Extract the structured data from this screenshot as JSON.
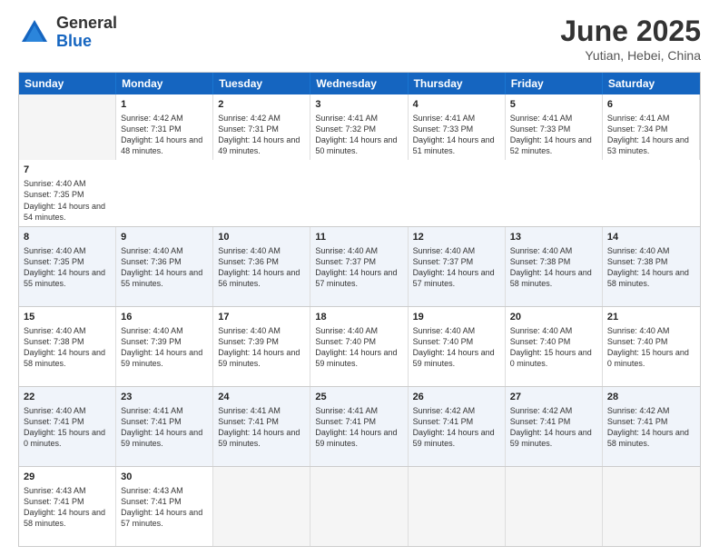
{
  "logo": {
    "general": "General",
    "blue": "Blue"
  },
  "title": {
    "month": "June 2025",
    "location": "Yutian, Hebei, China"
  },
  "days": [
    "Sunday",
    "Monday",
    "Tuesday",
    "Wednesday",
    "Thursday",
    "Friday",
    "Saturday"
  ],
  "rows": [
    [
      {
        "day": "",
        "empty": true
      },
      {
        "day": "1",
        "rise": "4:42 AM",
        "set": "7:31 PM",
        "daylight": "14 hours and 48 minutes."
      },
      {
        "day": "2",
        "rise": "4:42 AM",
        "set": "7:31 PM",
        "daylight": "14 hours and 49 minutes."
      },
      {
        "day": "3",
        "rise": "4:41 AM",
        "set": "7:32 PM",
        "daylight": "14 hours and 50 minutes."
      },
      {
        "day": "4",
        "rise": "4:41 AM",
        "set": "7:33 PM",
        "daylight": "14 hours and 51 minutes."
      },
      {
        "day": "5",
        "rise": "4:41 AM",
        "set": "7:33 PM",
        "daylight": "14 hours and 52 minutes."
      },
      {
        "day": "6",
        "rise": "4:41 AM",
        "set": "7:34 PM",
        "daylight": "14 hours and 53 minutes."
      },
      {
        "day": "7",
        "rise": "4:40 AM",
        "set": "7:35 PM",
        "daylight": "14 hours and 54 minutes."
      }
    ],
    [
      {
        "day": "8",
        "rise": "4:40 AM",
        "set": "7:35 PM",
        "daylight": "14 hours and 55 minutes."
      },
      {
        "day": "9",
        "rise": "4:40 AM",
        "set": "7:36 PM",
        "daylight": "14 hours and 55 minutes."
      },
      {
        "day": "10",
        "rise": "4:40 AM",
        "set": "7:36 PM",
        "daylight": "14 hours and 56 minutes."
      },
      {
        "day": "11",
        "rise": "4:40 AM",
        "set": "7:37 PM",
        "daylight": "14 hours and 57 minutes."
      },
      {
        "day": "12",
        "rise": "4:40 AM",
        "set": "7:37 PM",
        "daylight": "14 hours and 57 minutes."
      },
      {
        "day": "13",
        "rise": "4:40 AM",
        "set": "7:38 PM",
        "daylight": "14 hours and 58 minutes."
      },
      {
        "day": "14",
        "rise": "4:40 AM",
        "set": "7:38 PM",
        "daylight": "14 hours and 58 minutes."
      }
    ],
    [
      {
        "day": "15",
        "rise": "4:40 AM",
        "set": "7:38 PM",
        "daylight": "14 hours and 58 minutes."
      },
      {
        "day": "16",
        "rise": "4:40 AM",
        "set": "7:39 PM",
        "daylight": "14 hours and 59 minutes."
      },
      {
        "day": "17",
        "rise": "4:40 AM",
        "set": "7:39 PM",
        "daylight": "14 hours and 59 minutes."
      },
      {
        "day": "18",
        "rise": "4:40 AM",
        "set": "7:40 PM",
        "daylight": "14 hours and 59 minutes."
      },
      {
        "day": "19",
        "rise": "4:40 AM",
        "set": "7:40 PM",
        "daylight": "14 hours and 59 minutes."
      },
      {
        "day": "20",
        "rise": "4:40 AM",
        "set": "7:40 PM",
        "daylight": "15 hours and 0 minutes."
      },
      {
        "day": "21",
        "rise": "4:40 AM",
        "set": "7:40 PM",
        "daylight": "15 hours and 0 minutes."
      }
    ],
    [
      {
        "day": "22",
        "rise": "4:40 AM",
        "set": "7:41 PM",
        "daylight": "15 hours and 0 minutes."
      },
      {
        "day": "23",
        "rise": "4:41 AM",
        "set": "7:41 PM",
        "daylight": "14 hours and 59 minutes."
      },
      {
        "day": "24",
        "rise": "4:41 AM",
        "set": "7:41 PM",
        "daylight": "14 hours and 59 minutes."
      },
      {
        "day": "25",
        "rise": "4:41 AM",
        "set": "7:41 PM",
        "daylight": "14 hours and 59 minutes."
      },
      {
        "day": "26",
        "rise": "4:42 AM",
        "set": "7:41 PM",
        "daylight": "14 hours and 59 minutes."
      },
      {
        "day": "27",
        "rise": "4:42 AM",
        "set": "7:41 PM",
        "daylight": "14 hours and 59 minutes."
      },
      {
        "day": "28",
        "rise": "4:42 AM",
        "set": "7:41 PM",
        "daylight": "14 hours and 58 minutes."
      }
    ],
    [
      {
        "day": "29",
        "rise": "4:43 AM",
        "set": "7:41 PM",
        "daylight": "14 hours and 58 minutes."
      },
      {
        "day": "30",
        "rise": "4:43 AM",
        "set": "7:41 PM",
        "daylight": "14 hours and 57 minutes."
      },
      {
        "day": "",
        "empty": true
      },
      {
        "day": "",
        "empty": true
      },
      {
        "day": "",
        "empty": true
      },
      {
        "day": "",
        "empty": true
      },
      {
        "day": "",
        "empty": true
      }
    ]
  ]
}
